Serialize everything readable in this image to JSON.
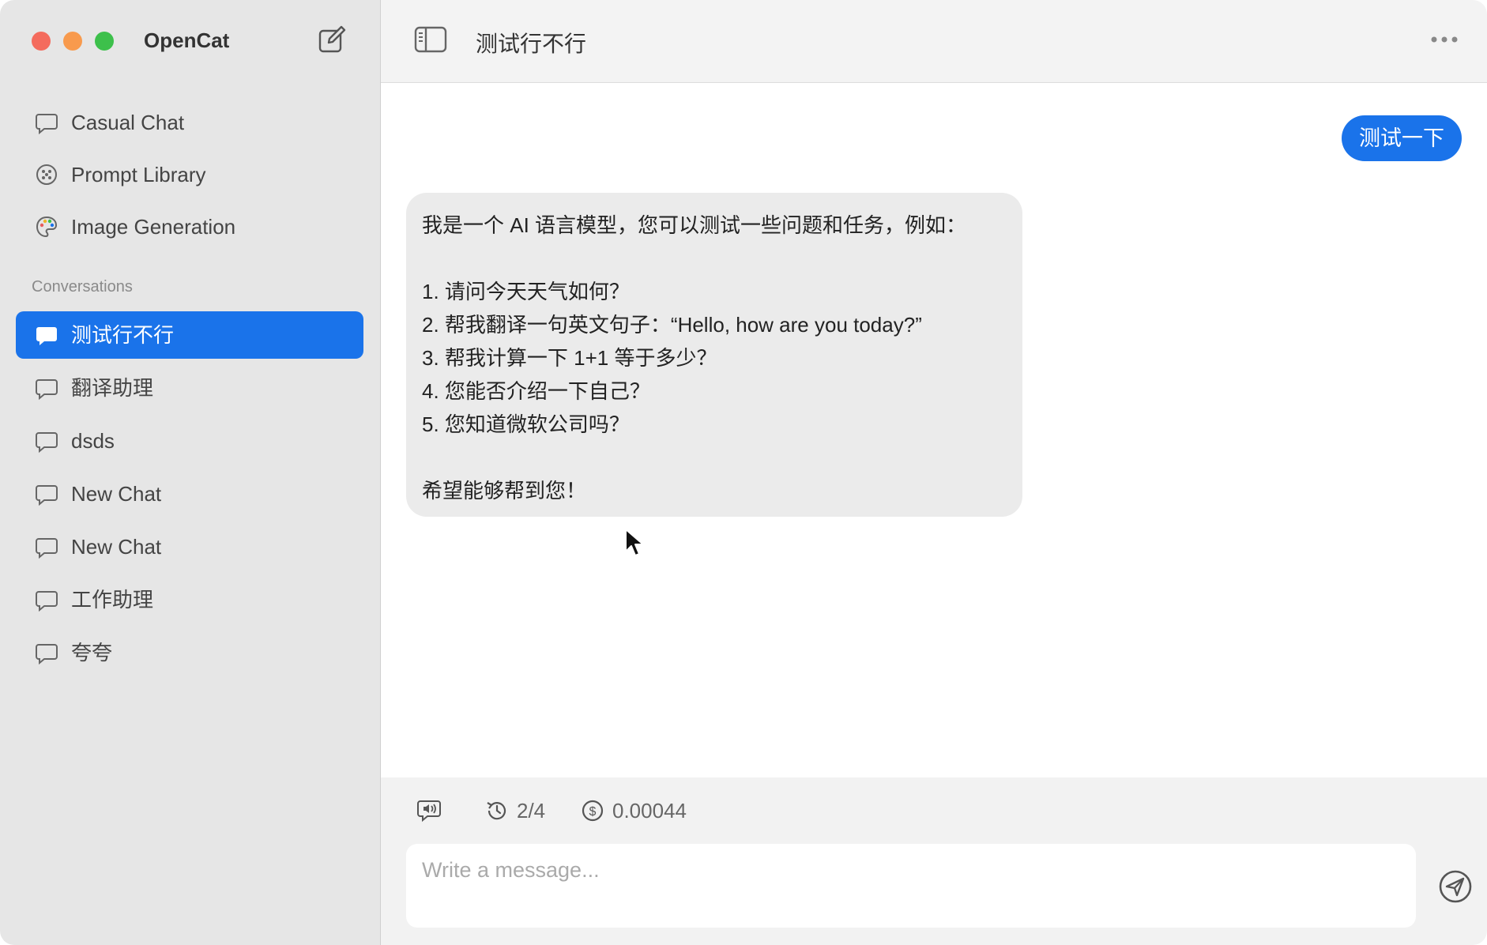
{
  "app": {
    "title": "OpenCat"
  },
  "sidebar": {
    "top_items": [
      {
        "label": "Casual Chat",
        "icon": "chat-bubble-icon"
      },
      {
        "label": "Prompt Library",
        "icon": "prompt-library-icon"
      },
      {
        "label": "Image Generation",
        "icon": "palette-icon"
      }
    ],
    "section_label": "Conversations",
    "conversations": [
      {
        "label": "测试行不行",
        "active": true
      },
      {
        "label": "翻译助理",
        "active": false
      },
      {
        "label": "dsds",
        "active": false
      },
      {
        "label": "New Chat",
        "active": false
      },
      {
        "label": "New Chat",
        "active": false
      },
      {
        "label": "工作助理",
        "active": false
      },
      {
        "label": "夸夸",
        "active": false
      }
    ]
  },
  "header": {
    "title": "测试行不行"
  },
  "messages": {
    "user": "测试一下",
    "assistant": [
      "我是一个 AI 语言模型，您可以测试一些问题和任务，例如：",
      "",
      "1. 请问今天天气如何？",
      "2. 帮我翻译一句英文句子：“Hello, how are you today?”",
      "3. 帮我计算一下 1+1 等于多少？",
      "4. 您能否介绍一下自己？",
      "5. 您知道微软公司吗？",
      "",
      "希望能够帮到您！"
    ]
  },
  "composer": {
    "history": "2/4",
    "cost": "0.00044",
    "placeholder": "Write a message..."
  },
  "colors": {
    "accent": "#1a73ea",
    "sidebar_bg": "#e6e6e6",
    "assistant_bubble": "#ebebeb"
  }
}
